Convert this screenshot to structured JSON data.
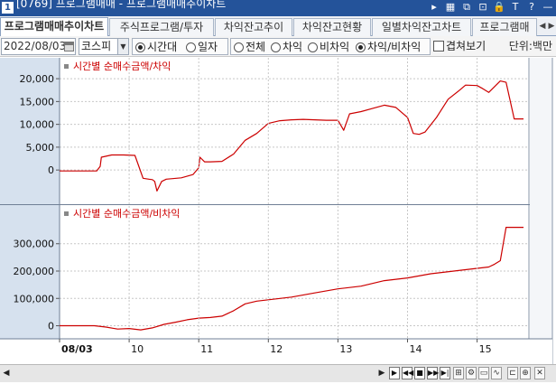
{
  "window": {
    "screen_number": "1",
    "title": "[0769] 프로그램매매 - 프로그램매매추이차트",
    "controls": [
      "▸",
      "▦",
      "⧉",
      "⊡",
      "🔒",
      "T",
      "?",
      "—"
    ]
  },
  "tabs": [
    "프로그램매매추이차트",
    "주식프로그램/투자",
    "차익잔고추이",
    "차익잔고현황",
    "일별차익잔고차트",
    "프로그램매"
  ],
  "toolbar": {
    "date": "2022/08/03",
    "market": "코스피",
    "period_options": [
      "시간대",
      "일자"
    ],
    "filter_options": [
      "전체",
      "차익",
      "비차익",
      "차익/비차익"
    ],
    "overlay_label": "겹쳐보기",
    "unit": "단위:백만"
  },
  "chart_data": [
    {
      "type": "line",
      "title": "시간별 순매수금액/차익",
      "yticks": [
        "20,000",
        "15,000",
        "10,000",
        "5,000",
        "0"
      ],
      "ylim": [
        -6300,
        21800
      ],
      "color": "#cc0000",
      "x": [
        "09:00",
        "09:25",
        "09:32",
        "09:35",
        "09:36",
        "09:45",
        "09:55",
        "10:05",
        "10:12",
        "10:17",
        "10:20",
        "10:22",
        "10:24",
        "10:28",
        "10:32",
        "10:45",
        "10:55",
        "11:00",
        "11:01",
        "11:05",
        "11:10",
        "11:20",
        "11:30",
        "11:40",
        "11:50",
        "12:00",
        "12:10",
        "12:20",
        "12:30",
        "12:40",
        "12:50",
        "13:00",
        "13:05",
        "13:10",
        "13:20",
        "13:30",
        "13:40",
        "13:50",
        "14:00",
        "14:05",
        "14:10",
        "14:15",
        "14:25",
        "14:35",
        "14:45",
        "14:50",
        "15:00",
        "15:05",
        "15:10",
        "15:20",
        "15:25",
        "15:32",
        "15:40"
      ],
      "values": [
        -200,
        -200,
        -200,
        800,
        2800,
        3300,
        3300,
        3200,
        -1800,
        -2000,
        -2100,
        -2500,
        -4600,
        -2500,
        -2000,
        -1700,
        -1000,
        500,
        2800,
        1800,
        1800,
        1900,
        3500,
        6500,
        8000,
        10200,
        10800,
        11000,
        11100,
        11000,
        10900,
        10900,
        8700,
        12300,
        12800,
        13500,
        14200,
        13700,
        11500,
        8000,
        7800,
        8300,
        11500,
        15500,
        17500,
        18600,
        18500,
        17800,
        17000,
        19500,
        19200,
        11200,
        11200
      ]
    },
    {
      "type": "line",
      "title": "시간별 순매수금액/비차익",
      "yticks": [
        "300,000",
        "200,000",
        "100,000",
        "0"
      ],
      "ylim": [
        -28000,
        395000
      ],
      "color": "#cc0000",
      "x": [
        "09:00",
        "09:30",
        "09:40",
        "09:50",
        "10:00",
        "10:10",
        "10:20",
        "10:30",
        "10:40",
        "10:50",
        "11:00",
        "11:10",
        "11:20",
        "11:30",
        "11:40",
        "11:50",
        "12:00",
        "12:20",
        "12:40",
        "13:00",
        "13:20",
        "13:40",
        "14:00",
        "14:20",
        "14:40",
        "15:00",
        "15:10",
        "15:15",
        "15:20",
        "15:25",
        "15:40"
      ],
      "values": [
        0,
        0,
        -5000,
        -12000,
        -10000,
        -15000,
        -8000,
        5000,
        13000,
        22000,
        28000,
        30000,
        35000,
        55000,
        80000,
        90000,
        95000,
        105000,
        120000,
        135000,
        145000,
        165000,
        175000,
        190000,
        200000,
        210000,
        215000,
        225000,
        238000,
        360000,
        360000
      ]
    }
  ],
  "xaxis": {
    "ticks": [
      "08/03",
      "10",
      "11",
      "12",
      "13",
      "14",
      "15"
    ]
  },
  "bottom_tools": [
    "▶",
    "◀◀",
    "■",
    "▶▶",
    "▶|",
    "⊞",
    "⚙",
    "▭",
    "∿",
    "⊏",
    "⊕",
    "✕"
  ]
}
